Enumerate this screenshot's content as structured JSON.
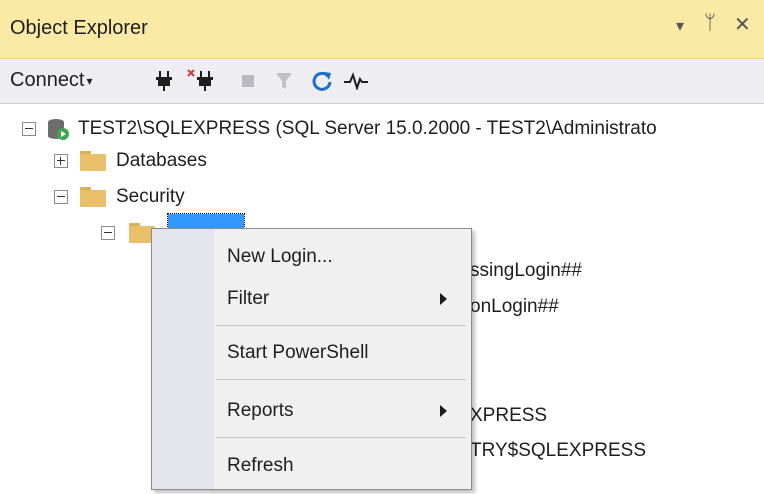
{
  "panel": {
    "title": "Object Explorer",
    "dropdown_glyph": "▾",
    "pin_glyph": "ᛘ",
    "close_glyph": "✕"
  },
  "toolbar": {
    "connect_label": "Connect",
    "connect_caret": "▾",
    "icons": [
      "connect-plug-icon",
      "disconnect-plug-icon",
      "stop-icon",
      "filter-icon",
      "refresh-icon",
      "activity-monitor-icon"
    ]
  },
  "tree": {
    "server_label": "TEST2\\SQLEXPRESS (SQL Server 15.0.2000 - TEST2\\Administrato",
    "databases_label": "Databases",
    "security_label": "Security",
    "partial_1": "ssingLogin##",
    "partial_2": "onLogin##",
    "partial_3": "XPRESS",
    "partial_4": "TRY$SQLEXPRESS"
  },
  "context_menu": {
    "items": [
      {
        "label": "New Login..."
      },
      {
        "label": "Filter"
      },
      {
        "label": "Start PowerShell"
      },
      {
        "label": "Reports"
      },
      {
        "label": "Refresh"
      }
    ]
  }
}
